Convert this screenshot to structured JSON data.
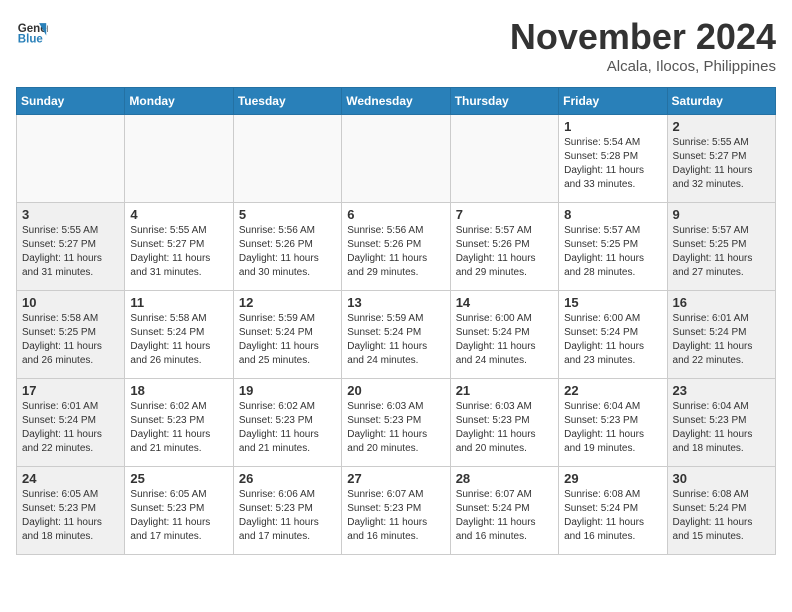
{
  "header": {
    "logo_line1": "General",
    "logo_line2": "Blue",
    "month": "November 2024",
    "location": "Alcala, Ilocos, Philippines"
  },
  "days_of_week": [
    "Sunday",
    "Monday",
    "Tuesday",
    "Wednesday",
    "Thursday",
    "Friday",
    "Saturday"
  ],
  "weeks": [
    [
      {
        "day": "",
        "info": "",
        "empty": true
      },
      {
        "day": "",
        "info": "",
        "empty": true
      },
      {
        "day": "",
        "info": "",
        "empty": true
      },
      {
        "day": "",
        "info": "",
        "empty": true
      },
      {
        "day": "",
        "info": "",
        "empty": true
      },
      {
        "day": "1",
        "info": "Sunrise: 5:54 AM\nSunset: 5:28 PM\nDaylight: 11 hours and 33 minutes.",
        "empty": false,
        "weekend": false
      },
      {
        "day": "2",
        "info": "Sunrise: 5:55 AM\nSunset: 5:27 PM\nDaylight: 11 hours and 32 minutes.",
        "empty": false,
        "weekend": true
      }
    ],
    [
      {
        "day": "3",
        "info": "Sunrise: 5:55 AM\nSunset: 5:27 PM\nDaylight: 11 hours and 31 minutes.",
        "empty": false,
        "weekend": true
      },
      {
        "day": "4",
        "info": "Sunrise: 5:55 AM\nSunset: 5:27 PM\nDaylight: 11 hours and 31 minutes.",
        "empty": false,
        "weekend": false
      },
      {
        "day": "5",
        "info": "Sunrise: 5:56 AM\nSunset: 5:26 PM\nDaylight: 11 hours and 30 minutes.",
        "empty": false,
        "weekend": false
      },
      {
        "day": "6",
        "info": "Sunrise: 5:56 AM\nSunset: 5:26 PM\nDaylight: 11 hours and 29 minutes.",
        "empty": false,
        "weekend": false
      },
      {
        "day": "7",
        "info": "Sunrise: 5:57 AM\nSunset: 5:26 PM\nDaylight: 11 hours and 29 minutes.",
        "empty": false,
        "weekend": false
      },
      {
        "day": "8",
        "info": "Sunrise: 5:57 AM\nSunset: 5:25 PM\nDaylight: 11 hours and 28 minutes.",
        "empty": false,
        "weekend": false
      },
      {
        "day": "9",
        "info": "Sunrise: 5:57 AM\nSunset: 5:25 PM\nDaylight: 11 hours and 27 minutes.",
        "empty": false,
        "weekend": true
      }
    ],
    [
      {
        "day": "10",
        "info": "Sunrise: 5:58 AM\nSunset: 5:25 PM\nDaylight: 11 hours and 26 minutes.",
        "empty": false,
        "weekend": true
      },
      {
        "day": "11",
        "info": "Sunrise: 5:58 AM\nSunset: 5:24 PM\nDaylight: 11 hours and 26 minutes.",
        "empty": false,
        "weekend": false
      },
      {
        "day": "12",
        "info": "Sunrise: 5:59 AM\nSunset: 5:24 PM\nDaylight: 11 hours and 25 minutes.",
        "empty": false,
        "weekend": false
      },
      {
        "day": "13",
        "info": "Sunrise: 5:59 AM\nSunset: 5:24 PM\nDaylight: 11 hours and 24 minutes.",
        "empty": false,
        "weekend": false
      },
      {
        "day": "14",
        "info": "Sunrise: 6:00 AM\nSunset: 5:24 PM\nDaylight: 11 hours and 24 minutes.",
        "empty": false,
        "weekend": false
      },
      {
        "day": "15",
        "info": "Sunrise: 6:00 AM\nSunset: 5:24 PM\nDaylight: 11 hours and 23 minutes.",
        "empty": false,
        "weekend": false
      },
      {
        "day": "16",
        "info": "Sunrise: 6:01 AM\nSunset: 5:24 PM\nDaylight: 11 hours and 22 minutes.",
        "empty": false,
        "weekend": true
      }
    ],
    [
      {
        "day": "17",
        "info": "Sunrise: 6:01 AM\nSunset: 5:24 PM\nDaylight: 11 hours and 22 minutes.",
        "empty": false,
        "weekend": true
      },
      {
        "day": "18",
        "info": "Sunrise: 6:02 AM\nSunset: 5:23 PM\nDaylight: 11 hours and 21 minutes.",
        "empty": false,
        "weekend": false
      },
      {
        "day": "19",
        "info": "Sunrise: 6:02 AM\nSunset: 5:23 PM\nDaylight: 11 hours and 21 minutes.",
        "empty": false,
        "weekend": false
      },
      {
        "day": "20",
        "info": "Sunrise: 6:03 AM\nSunset: 5:23 PM\nDaylight: 11 hours and 20 minutes.",
        "empty": false,
        "weekend": false
      },
      {
        "day": "21",
        "info": "Sunrise: 6:03 AM\nSunset: 5:23 PM\nDaylight: 11 hours and 20 minutes.",
        "empty": false,
        "weekend": false
      },
      {
        "day": "22",
        "info": "Sunrise: 6:04 AM\nSunset: 5:23 PM\nDaylight: 11 hours and 19 minutes.",
        "empty": false,
        "weekend": false
      },
      {
        "day": "23",
        "info": "Sunrise: 6:04 AM\nSunset: 5:23 PM\nDaylight: 11 hours and 18 minutes.",
        "empty": false,
        "weekend": true
      }
    ],
    [
      {
        "day": "24",
        "info": "Sunrise: 6:05 AM\nSunset: 5:23 PM\nDaylight: 11 hours and 18 minutes.",
        "empty": false,
        "weekend": true
      },
      {
        "day": "25",
        "info": "Sunrise: 6:05 AM\nSunset: 5:23 PM\nDaylight: 11 hours and 17 minutes.",
        "empty": false,
        "weekend": false
      },
      {
        "day": "26",
        "info": "Sunrise: 6:06 AM\nSunset: 5:23 PM\nDaylight: 11 hours and 17 minutes.",
        "empty": false,
        "weekend": false
      },
      {
        "day": "27",
        "info": "Sunrise: 6:07 AM\nSunset: 5:23 PM\nDaylight: 11 hours and 16 minutes.",
        "empty": false,
        "weekend": false
      },
      {
        "day": "28",
        "info": "Sunrise: 6:07 AM\nSunset: 5:24 PM\nDaylight: 11 hours and 16 minutes.",
        "empty": false,
        "weekend": false
      },
      {
        "day": "29",
        "info": "Sunrise: 6:08 AM\nSunset: 5:24 PM\nDaylight: 11 hours and 16 minutes.",
        "empty": false,
        "weekend": false
      },
      {
        "day": "30",
        "info": "Sunrise: 6:08 AM\nSunset: 5:24 PM\nDaylight: 11 hours and 15 minutes.",
        "empty": false,
        "weekend": true
      }
    ]
  ]
}
